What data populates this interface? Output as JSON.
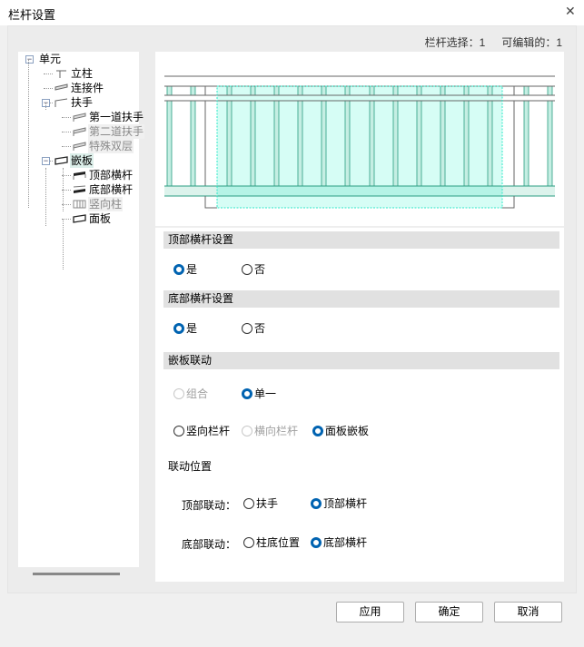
{
  "window": {
    "title": "栏杆设置",
    "close_icon": "close-icon"
  },
  "status": {
    "selected": "栏杆选择：1",
    "editable": "可编辑的：1"
  },
  "tree": [
    {
      "label": "单元",
      "level": 0,
      "expander": "−",
      "state": "normal",
      "icon": "none"
    },
    {
      "label": "立柱",
      "level": 1,
      "state": "normal",
      "icon": "post-icon"
    },
    {
      "label": "连接件",
      "level": 1,
      "state": "normal",
      "icon": "connector-icon"
    },
    {
      "label": "扶手",
      "level": 1,
      "expander": "−",
      "state": "normal",
      "icon": "handrail-icon"
    },
    {
      "label": "第一道扶手",
      "level": 2,
      "state": "normal",
      "icon": "rail-icon"
    },
    {
      "label": "第二道扶手",
      "level": 2,
      "state": "disabled",
      "icon": "rail-icon"
    },
    {
      "label": "特殊双层",
      "level": 2,
      "state": "disabled",
      "icon": "rail-icon"
    },
    {
      "label": "嵌板",
      "level": 1,
      "expander": "−",
      "state": "selected",
      "icon": "panel-icon"
    },
    {
      "label": "顶部横杆",
      "level": 2,
      "state": "normal",
      "icon": "top-rail-icon"
    },
    {
      "label": "底部横杆",
      "level": 2,
      "state": "normal",
      "icon": "bottom-rail-icon"
    },
    {
      "label": "竖向柱",
      "level": 2,
      "state": "disabled",
      "icon": "baluster-icon"
    },
    {
      "label": "面板",
      "level": 2,
      "state": "normal",
      "icon": "panel-icon"
    }
  ],
  "sections": {
    "top": {
      "title": "顶部横杆设置",
      "yes": "是",
      "no": "否",
      "value": "yes"
    },
    "bottom": {
      "title": "底部横杆设置",
      "yes": "是",
      "no": "否",
      "value": "yes"
    },
    "link": {
      "title": "嵌板联动",
      "combo": "组合",
      "single": "单一",
      "vertical": "竖向栏杆",
      "horizontal": "横向栏杆",
      "panel": "面板嵌板",
      "position_label": "联动位置",
      "top_label": "顶部联动：",
      "top_opt1": "扶手",
      "top_opt2": "顶部横杆",
      "bottom_label": "底部联动：",
      "bottom_opt1": "柱底位置",
      "bottom_opt2": "底部横杆"
    }
  },
  "buttons": {
    "apply": "应用",
    "ok": "确定",
    "cancel": "取消"
  },
  "colors": {
    "accent": "#0063b1",
    "highlight": "#d6fdf5",
    "stroke": "#2a9d82"
  }
}
